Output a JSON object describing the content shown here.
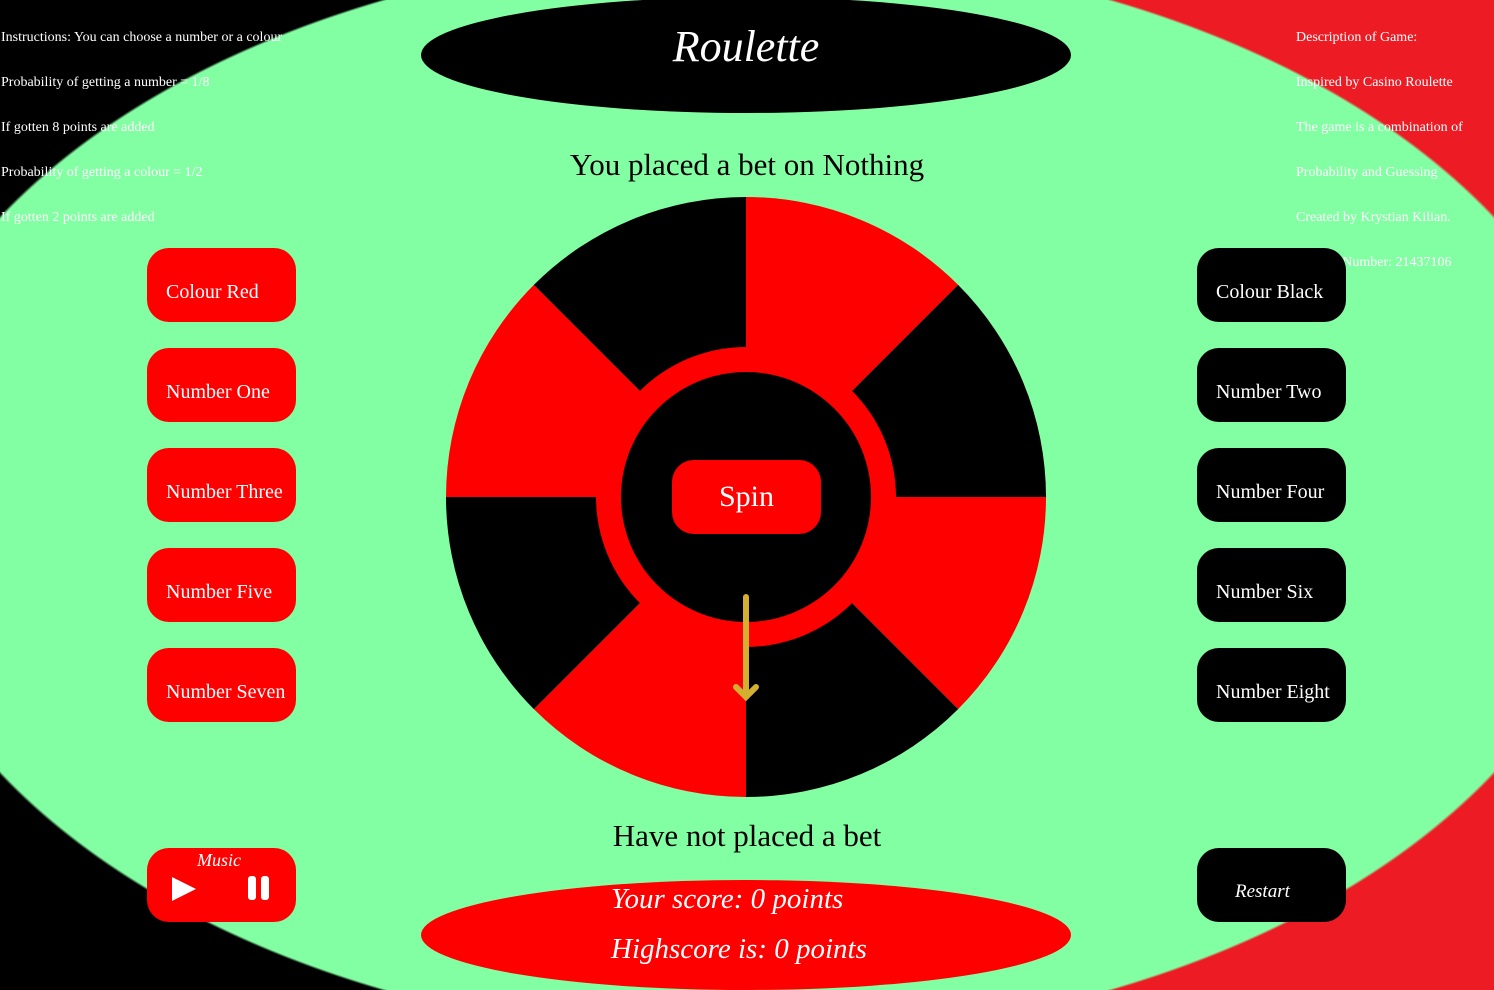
{
  "instructions": [
    "Instructions: You can choose a number or a colour",
    "Probability of getting a number = 1/8",
    "If gotten 8 points are added",
    "Probability of getting a colour = 1/2",
    "If gotten 2 points are added"
  ],
  "description": [
    "Description of Game:",
    "Inspired by Casino Roulette",
    "The game is a combination of",
    "Probability and Guessing",
    "Created by Krystian Kilian.",
    "Student Number: 21437106"
  ],
  "title": "Roulette",
  "bet_status": "You placed a bet on Nothing",
  "bet_message": "Have not placed a bet",
  "spin_label": "Spin",
  "left_buttons": [
    "Colour Red",
    "Number One",
    "Number Three",
    "Number Five",
    "Number Seven"
  ],
  "right_buttons": [
    "Colour Black",
    "Number Two",
    "Number Four",
    "Number Six",
    "Number Eight"
  ],
  "music_label": "Music",
  "restart_label": "Restart",
  "score": "Your score: 0 points",
  "highscore": "Highscore is: 0 points",
  "colors": {
    "red": "#ff0000",
    "black": "#000000",
    "green": "#83ffa3",
    "arrow": "#d4b030"
  }
}
